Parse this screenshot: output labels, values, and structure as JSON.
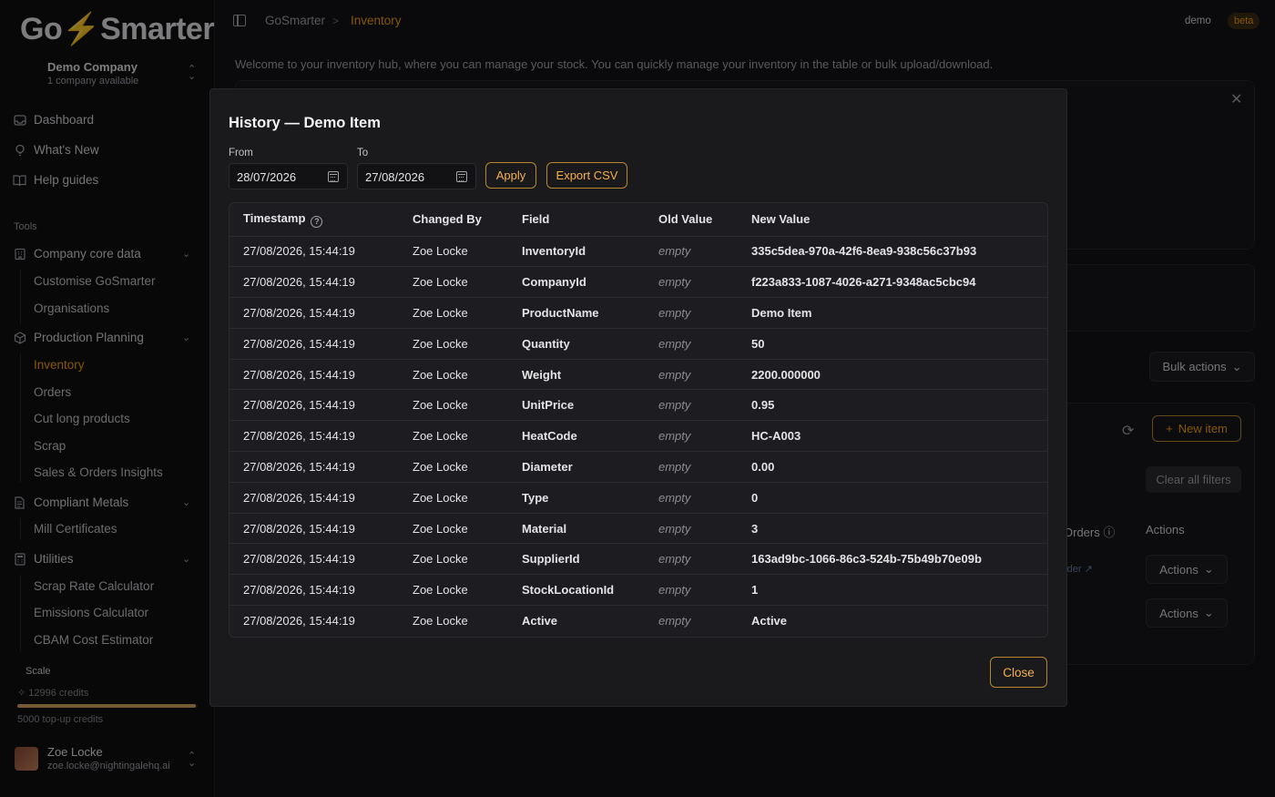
{
  "app": {
    "logo_text_a": "Go",
    "logo_bolt": "⚡",
    "logo_text_b": "Smarter",
    "company_name": "Demo Company",
    "company_sub": "1 company available"
  },
  "nav": {
    "dashboard": "Dashboard",
    "whats_new": "What's New",
    "help_guides": "Help guides",
    "tools_label": "Tools",
    "company_core": "Company core data",
    "customise": "Customise GoSmarter",
    "organisations": "Organisations",
    "production_planning": "Production Planning",
    "inventory": "Inventory",
    "orders": "Orders",
    "cut_long": "Cut long products",
    "scrap": "Scrap",
    "sales_insights": "Sales & Orders Insights",
    "compliant_metals": "Compliant Metals",
    "mill_certs": "Mill Certificates",
    "utilities": "Utilities",
    "scrap_rate": "Scrap Rate Calculator",
    "emissions": "Emissions Calculator",
    "cbam": "CBAM Cost Estimator"
  },
  "plan": {
    "scale_label": "Scale",
    "credits": "12996 credits",
    "credits_fill": 0.99,
    "topup": "5000 top-up credits"
  },
  "user": {
    "name": "Zoe Locke",
    "email": "zoe.locke@nightingalehq.ai"
  },
  "header": {
    "breadcrumb_root": "GoSmarter",
    "breadcrumb_sep": ">",
    "breadcrumb_current": "Inventory",
    "tag_demo": "demo",
    "tag_beta": "beta",
    "welcome": "Welcome to your inventory hub, where you can manage your stock. You can quickly manage your inventory in the table or bulk upload/download."
  },
  "background": {
    "bulk_actions": "Bulk actions",
    "new_item": "New item",
    "clear_filters": "Clear all filters",
    "orders_col": "Orders",
    "actions_col": "Actions",
    "order_link": "rder",
    "actions_btn": "Actions"
  },
  "modal": {
    "title": "History — Demo Item",
    "from_label": "From",
    "to_label": "To",
    "from_value": "28/07/2026",
    "to_value": "27/08/2026",
    "apply": "Apply",
    "export_csv": "Export CSV",
    "close": "Close",
    "columns": [
      "Timestamp",
      "Changed By",
      "Field",
      "Old Value",
      "New Value"
    ],
    "rows": [
      {
        "timestamp": "27/08/2026, 15:44:19",
        "changed_by": "Zoe Locke",
        "field": "InventoryId",
        "old": "empty",
        "new": "335c5dea-970a-42f6-8ea9-938c56c37b93"
      },
      {
        "timestamp": "27/08/2026, 15:44:19",
        "changed_by": "Zoe Locke",
        "field": "CompanyId",
        "old": "empty",
        "new": "f223a833-1087-4026-a271-9348ac5cbc94"
      },
      {
        "timestamp": "27/08/2026, 15:44:19",
        "changed_by": "Zoe Locke",
        "field": "ProductName",
        "old": "empty",
        "new": "Demo Item"
      },
      {
        "timestamp": "27/08/2026, 15:44:19",
        "changed_by": "Zoe Locke",
        "field": "Quantity",
        "old": "empty",
        "new": "50"
      },
      {
        "timestamp": "27/08/2026, 15:44:19",
        "changed_by": "Zoe Locke",
        "field": "Weight",
        "old": "empty",
        "new": "2200.000000"
      },
      {
        "timestamp": "27/08/2026, 15:44:19",
        "changed_by": "Zoe Locke",
        "field": "UnitPrice",
        "old": "empty",
        "new": "0.95"
      },
      {
        "timestamp": "27/08/2026, 15:44:19",
        "changed_by": "Zoe Locke",
        "field": "HeatCode",
        "old": "empty",
        "new": "HC-A003"
      },
      {
        "timestamp": "27/08/2026, 15:44:19",
        "changed_by": "Zoe Locke",
        "field": "Diameter",
        "old": "empty",
        "new": "0.00"
      },
      {
        "timestamp": "27/08/2026, 15:44:19",
        "changed_by": "Zoe Locke",
        "field": "Type",
        "old": "empty",
        "new": "0"
      },
      {
        "timestamp": "27/08/2026, 15:44:19",
        "changed_by": "Zoe Locke",
        "field": "Material",
        "old": "empty",
        "new": "3"
      },
      {
        "timestamp": "27/08/2026, 15:44:19",
        "changed_by": "Zoe Locke",
        "field": "SupplierId",
        "old": "empty",
        "new": "163ad9bc-1066-86c3-524b-75b49b70e09b"
      },
      {
        "timestamp": "27/08/2026, 15:44:19",
        "changed_by": "Zoe Locke",
        "field": "StockLocationId",
        "old": "empty",
        "new": "1"
      },
      {
        "timestamp": "27/08/2026, 15:44:19",
        "changed_by": "Zoe Locke",
        "field": "Active",
        "old": "empty",
        "new": "Active"
      }
    ]
  },
  "colors": {
    "accent": "#f59e0b",
    "background": "#131316",
    "modal": "#1a1a1d"
  }
}
